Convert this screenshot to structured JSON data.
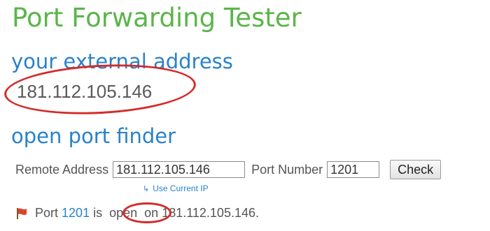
{
  "page": {
    "title": "Port Forwarding Tester"
  },
  "external": {
    "heading": "your external address",
    "ip": "181.112.105.146"
  },
  "finder": {
    "heading": "open port finder",
    "remote_label": "Remote Address",
    "remote_value": "181.112.105.146",
    "port_label": "Port Number",
    "port_value": "1201",
    "check_label": "Check",
    "use_current_ip": "Use Current IP"
  },
  "result": {
    "port_word": "Port",
    "port": "1201",
    "is_word": "is",
    "status": "open",
    "on_text": "on 181.112.105.146.",
    "status_color": "#d52a2a"
  },
  "colors": {
    "title": "#5bb54a",
    "heading": "#2a82c9",
    "annotation": "#d52a2a"
  }
}
